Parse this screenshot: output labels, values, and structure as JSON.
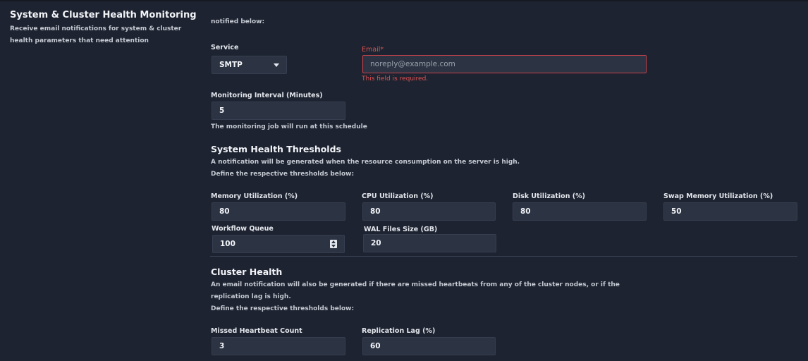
{
  "section": {
    "title": "System & Cluster Health Monitoring",
    "desc": "Receive email notifications for system & cluster health parameters that need attention"
  },
  "top_note": "notified below:",
  "service": {
    "label": "Service",
    "value": "SMTP"
  },
  "email": {
    "label": "Email*",
    "placeholder": "noreply@example.com",
    "error": "This field is required."
  },
  "interval": {
    "label": "Monitoring Interval (Minutes)",
    "value": "5",
    "help": "The monitoring job will run at this schedule"
  },
  "system": {
    "title": "System Health Thresholds",
    "desc1": "A notification will be generated when the resource consumption on the server is high.",
    "desc2": "Define the respective thresholds below:",
    "memory": {
      "label": "Memory Utilization (%)",
      "value": "80"
    },
    "cpu": {
      "label": "CPU Utilization (%)",
      "value": "80"
    },
    "disk": {
      "label": "Disk Utilization (%)",
      "value": "80"
    },
    "swap": {
      "label": "Swap Memory Utilization (%)",
      "value": "50"
    },
    "workflow": {
      "label": "Workflow Queue",
      "value": "100"
    },
    "wal": {
      "label": "WAL Files Size (GB)",
      "value": "20"
    }
  },
  "cluster": {
    "title": "Cluster Health",
    "desc1": "An email notification will also be generated if there are missed heartbeats from any of the cluster nodes, or if the",
    "desc2": "replication lag is high.",
    "desc3": "Define the respective thresholds below:",
    "heartbeat": {
      "label": "Missed Heartbeat Count",
      "value": "3"
    },
    "replication": {
      "label": "Replication Lag (%)",
      "value": "60"
    }
  },
  "colors": {
    "background": "#1d2330",
    "input_bg": "#2c3342",
    "error": "#d9534f"
  }
}
